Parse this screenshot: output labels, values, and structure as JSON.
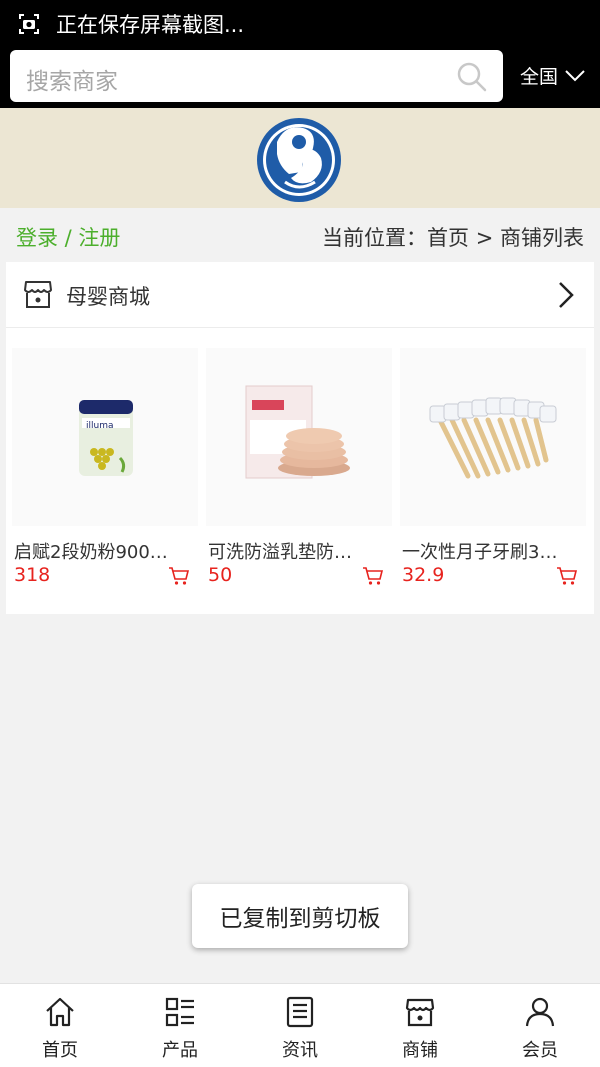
{
  "status": {
    "text": "正在保存屏幕截图..."
  },
  "search": {
    "placeholder": "搜索商家",
    "region": "全国"
  },
  "breadcrumb": {
    "login": "登录 / 注册",
    "path": "当前位置：首页 > 商铺列表"
  },
  "store": {
    "name": "母婴商城",
    "products": [
      {
        "name": "启赋2段奶粉900…",
        "price": "318"
      },
      {
        "name": "可洗防溢乳垫防…",
        "price": "50"
      },
      {
        "name": "一次性月子牙刷3…",
        "price": "32.9"
      }
    ]
  },
  "toast": "已复制到剪切板",
  "tabs": [
    "首页",
    "产品",
    "资讯",
    "商铺",
    "会员"
  ],
  "colors": {
    "accent_green": "#4caf2c",
    "price_red": "#e7231e",
    "banner_bg": "#ece6d3"
  }
}
